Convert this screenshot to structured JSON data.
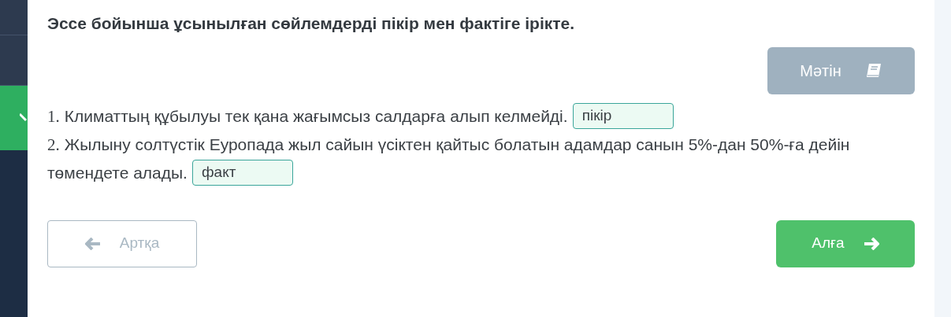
{
  "sidebar": {
    "items": [
      {
        "selected": false
      },
      {
        "selected": false
      },
      {
        "selected": true
      }
    ]
  },
  "instruction": "Эссе бойынша ұсынылған сөйлемдерді пікір мен фактіге ірікте.",
  "text_button": {
    "label": "Мәтін"
  },
  "sentences": [
    {
      "number": "1.",
      "lines": [
        "Климаттың құбылуы тек қана жағымсыз салдарға алып келмейді."
      ],
      "answer": "пікір"
    },
    {
      "number": "2.",
      "lines": [
        "Жылыну солтүстік Еуропада жыл сайын үсіктен қайтыс болатын адамдар санын 5%-дан 50%-ға дейін",
        "төмендете алады."
      ],
      "answer": "факт"
    }
  ],
  "back_button": {
    "label": "Артқа",
    "disabled": true
  },
  "next_button": {
    "label": "Алға",
    "disabled": false
  }
}
